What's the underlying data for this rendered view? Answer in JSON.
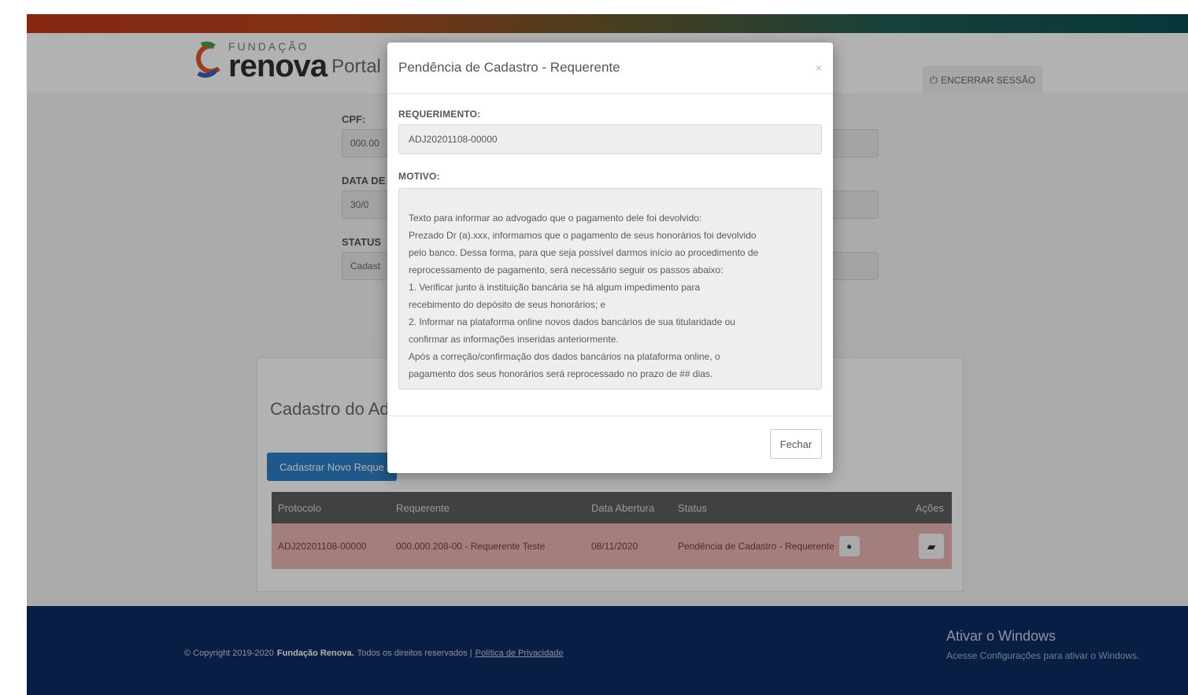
{
  "header": {
    "logo_fundacao": "FUNDAÇÃO",
    "logo_renova": "renova",
    "logo_portal": "Portal",
    "logout_label": "ENCERRAR SESSÃO",
    "power_icon": "⏻"
  },
  "form": {
    "cpf_label": "CPF:",
    "cpf_value": "000.00",
    "data_label": "DATA DE",
    "data_value": "30/0",
    "status_label": "STATUS",
    "status_value": "Cadast"
  },
  "main": {
    "panel_title": "Cadastro do Adv",
    "new_button": "Cadastrar Novo Reque",
    "columns": [
      "Protocolo",
      "Requerente",
      "Data Abertura",
      "Status",
      "Ações"
    ],
    "row": {
      "protocolo": "ADJ20201108-00000",
      "requerente": "000.000.208-00 - Requerente Teste",
      "data": "08/11/2020",
      "status": "Pendência de Cadastro - Requerente",
      "info_icon": "●",
      "folder_icon": "▰"
    }
  },
  "modal": {
    "title": "Pendência de Cadastro - Requerente",
    "close_symbol": "×",
    "requerimento_label": "REQUERIMENTO:",
    "requerimento_value": "ADJ20201108-00000",
    "motivo_label": "MOTIVO:",
    "motivo_lines": [
      "Texto para informar ao advogado que o pagamento dele foi devolvido:",
      "Prezado Dr (a).xxx, informamos que o pagamento de seus honorários foi devolvido",
      "pelo banco. Dessa forma, para que seja possível darmos início ao procedimento de",
      "reprocessamento de pagamento, será necessário seguir os passos abaixo:",
      "1. Verificar junto à instituição bancária se há algum impedimento para",
      "recebimento do depósito de seus honorários; e",
      "2. Informar na plataforma online novos dados bancários de sua titularidade ou",
      "confirmar as informações inseridas anteriormente.",
      "Após a correção/confirmação dos dados bancários na plataforma online, o",
      "pagamento dos seus honorários será reprocessado no prazo de ## dias."
    ],
    "close_button": "Fechar"
  },
  "footer": {
    "copyright": "© Copyright 2019-2020",
    "brand": "Fundação Renova.",
    "rights": "Todos os direitos reservados |",
    "privacy_link": "Política de Privacidade",
    "windows_title": "Ativar o Windows",
    "windows_sub": "Acesse Configurações para ativar o Windows."
  },
  "colors": {
    "accent_blue": "#2d7fc6",
    "footer_navy": "#0d2c63",
    "row_pending": "#e8b7b2",
    "table_header": "#5d5d5d"
  }
}
